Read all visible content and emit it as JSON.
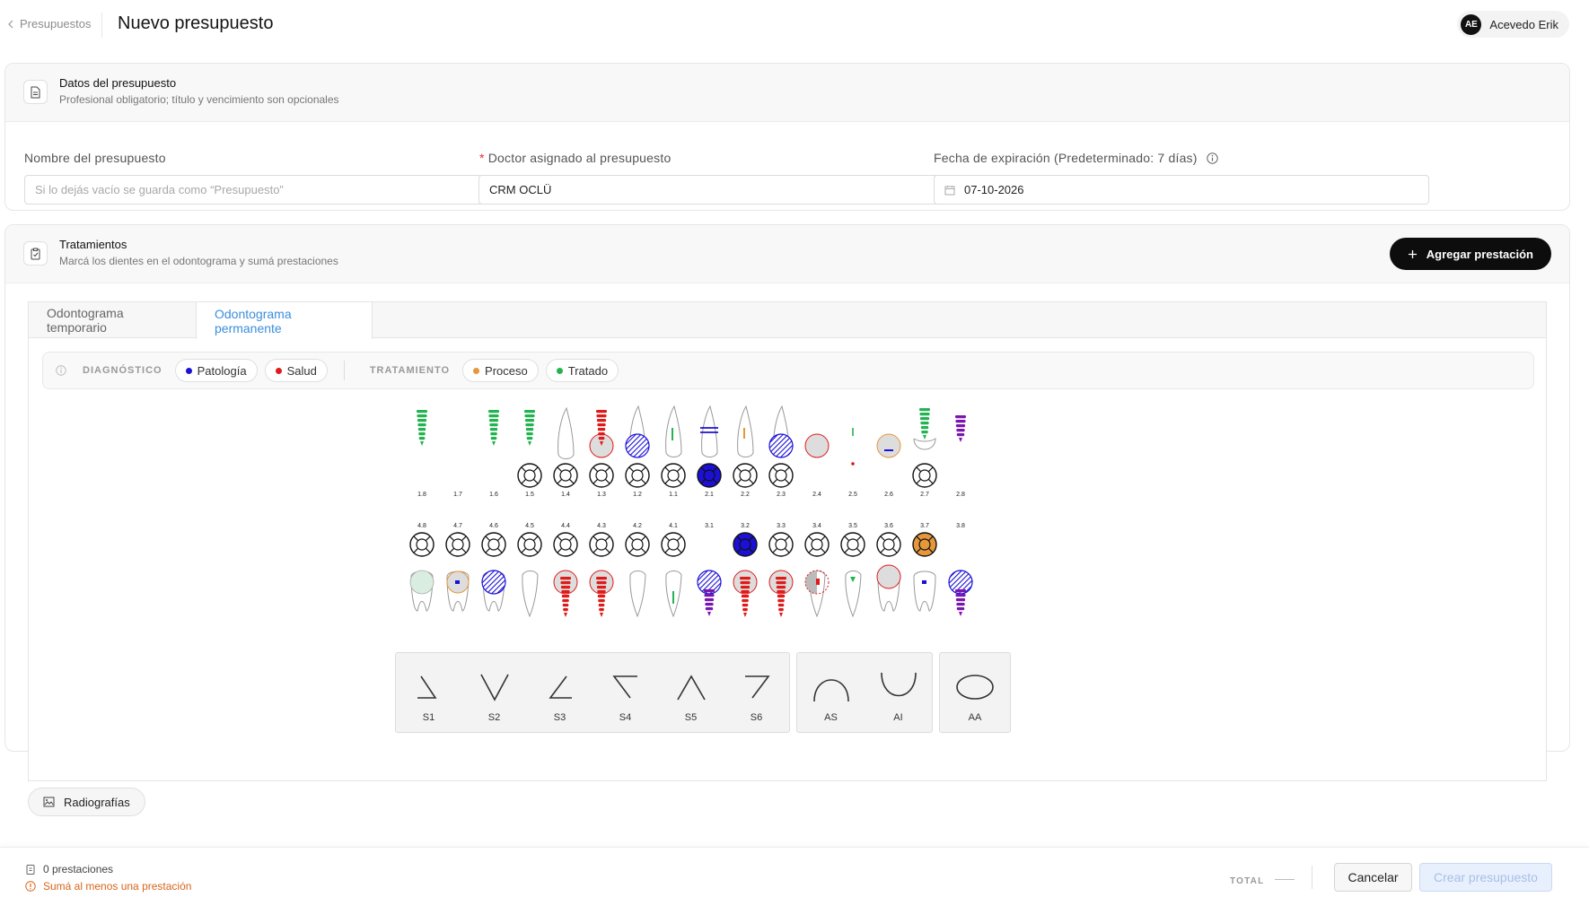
{
  "header": {
    "back_label": "Presupuestos",
    "page_title": "Nuevo presupuesto",
    "user": {
      "initials": "AE",
      "name": "Acevedo Erik"
    }
  },
  "datos": {
    "title": "Datos del presupuesto",
    "subtitle": "Profesional obligatorio; título y vencimiento son opcionales",
    "name_label": "Nombre del presupuesto",
    "name_placeholder": "Si lo dejás vacío se guarda como “Presupuesto”",
    "doctor_required_mark": "*",
    "doctor_label": "Doctor asignado al presupuesto",
    "doctor_value": "CRM OCLÜ",
    "expiry_label": "Fecha de expiración (Predeterminado: 7 días)",
    "expiry_value": "07-10-2026"
  },
  "tratamientos": {
    "title": "Tratamientos",
    "subtitle": "Marcá los dientes en el odontograma y sumá prestaciones",
    "add_label": "Agregar prestación"
  },
  "tabs": [
    {
      "label": "Odontograma temporario",
      "active": false
    },
    {
      "label": "Odontograma permanente",
      "active": true
    }
  ],
  "legend": {
    "diagnostico_title": "DIAGNÓSTICO",
    "patologia": "Patología",
    "salud": "Salud",
    "tratamiento_title": "TRATAMIENTO",
    "proceso": "Proceso",
    "tratado": "Tratado"
  },
  "colors": {
    "patologia": "#1c10d6",
    "salud": "#e01919",
    "proceso": "#e5973a",
    "tratado": "#23b350"
  },
  "chart_data": {
    "type": "table",
    "upper_numbers": [
      "1.8",
      "1.7",
      "1.6",
      "1.5",
      "1.4",
      "1.3",
      "1.2",
      "1.1",
      "2.1",
      "2.2",
      "2.3",
      "2.4",
      "2.5",
      "2.6",
      "2.7",
      "2.8"
    ],
    "lower_numbers": [
      "4.8",
      "4.7",
      "4.6",
      "4.5",
      "4.4",
      "4.3",
      "4.2",
      "4.1",
      "3.1",
      "3.2",
      "3.3",
      "3.4",
      "3.5",
      "3.6",
      "3.7",
      "3.8"
    ],
    "upper_teeth": [
      {
        "num": "1.8",
        "mark": "implant-tratado",
        "disc": false,
        "disc_fill": "none"
      },
      {
        "num": "1.7",
        "mark": "none",
        "disc": false,
        "disc_fill": "none"
      },
      {
        "num": "1.6",
        "mark": "implant-tratado",
        "disc": false,
        "disc_fill": "none"
      },
      {
        "num": "1.5",
        "mark": "implant-tratado",
        "disc": true,
        "disc_fill": "none"
      },
      {
        "num": "1.4",
        "mark": "tooth",
        "disc": true,
        "disc_fill": "none"
      },
      {
        "num": "1.3",
        "mark": "implant-salud-circle",
        "disc": true,
        "disc_fill": "none"
      },
      {
        "num": "1.2",
        "mark": "crown-patologia",
        "disc": true,
        "disc_fill": "none"
      },
      {
        "num": "1.1",
        "mark": "tooth-tratado-line",
        "disc": true,
        "disc_fill": "none"
      },
      {
        "num": "2.1",
        "mark": "tooth-patologia-lines",
        "disc": true,
        "disc_fill": "patologia"
      },
      {
        "num": "2.2",
        "mark": "tooth-proceso-line",
        "disc": true,
        "disc_fill": "none"
      },
      {
        "num": "2.3",
        "mark": "crown-patologia",
        "disc": true,
        "disc_fill": "none"
      },
      {
        "num": "2.4",
        "mark": "grey-circle",
        "disc": false,
        "disc_fill": "none"
      },
      {
        "num": "2.5",
        "mark": "small-marks",
        "disc": false,
        "disc_fill": "none"
      },
      {
        "num": "2.6",
        "mark": "grey-circle-proceso",
        "disc": false,
        "disc_fill": "none"
      },
      {
        "num": "2.7",
        "mark": "implant-tratado-molar",
        "disc": true,
        "disc_fill": "none"
      },
      {
        "num": "2.8",
        "mark": "implant-purple",
        "disc": false,
        "disc_fill": "none"
      }
    ],
    "lower_teeth": [
      {
        "num": "4.8",
        "mark": "molar-tratado",
        "disc": true,
        "disc_fill": "none"
      },
      {
        "num": "4.7",
        "mark": "molar-proceso-dot",
        "disc": true,
        "disc_fill": "none"
      },
      {
        "num": "4.6",
        "mark": "crown-patologia-molar",
        "disc": true,
        "disc_fill": "none"
      },
      {
        "num": "4.5",
        "mark": "tooth",
        "disc": true,
        "disc_fill": "none"
      },
      {
        "num": "4.4",
        "mark": "implant-salud-circle",
        "disc": true,
        "disc_fill": "none"
      },
      {
        "num": "4.3",
        "mark": "implant-salud-circle",
        "disc": true,
        "disc_fill": "none"
      },
      {
        "num": "4.2",
        "mark": "tooth",
        "disc": true,
        "disc_fill": "none"
      },
      {
        "num": "4.1",
        "mark": "tooth-tratado-line",
        "disc": true,
        "disc_fill": "none"
      },
      {
        "num": "3.1",
        "mark": "crown-implant-patologia",
        "disc": false,
        "disc_fill": "none"
      },
      {
        "num": "3.2",
        "mark": "implant-salud-circle",
        "disc": true,
        "disc_fill": "patologia"
      },
      {
        "num": "3.3",
        "mark": "implant-salud-circle",
        "disc": true,
        "disc_fill": "none"
      },
      {
        "num": "3.4",
        "mark": "half-grey-salud",
        "disc": true,
        "disc_fill": "none"
      },
      {
        "num": "3.5",
        "mark": "tooth-tratado-dot",
        "disc": true,
        "disc_fill": "none"
      },
      {
        "num": "3.6",
        "mark": "molar-salud-circle",
        "disc": true,
        "disc_fill": "none"
      },
      {
        "num": "3.7",
        "mark": "molar-patologia-dot",
        "disc": true,
        "disc_fill": "proceso"
      },
      {
        "num": "3.8",
        "mark": "crown-implant-patologia",
        "disc": false,
        "disc_fill": "none"
      }
    ]
  },
  "tools": [
    {
      "label": "S1",
      "group": 1
    },
    {
      "label": "S2",
      "group": 1
    },
    {
      "label": "S3",
      "group": 1
    },
    {
      "label": "S4",
      "group": 1
    },
    {
      "label": "S5",
      "group": 1
    },
    {
      "label": "S6",
      "group": 1
    },
    {
      "label": "AS",
      "group": 2
    },
    {
      "label": "AI",
      "group": 2
    },
    {
      "label": "AA",
      "group": 3
    }
  ],
  "radiografias_label": "Radiografías",
  "footer": {
    "count": "0 prestaciones",
    "warning": "Sumá al menos una prestación",
    "total_label": "TOTAL",
    "cancel": "Cancelar",
    "create": "Crear presupuesto"
  }
}
